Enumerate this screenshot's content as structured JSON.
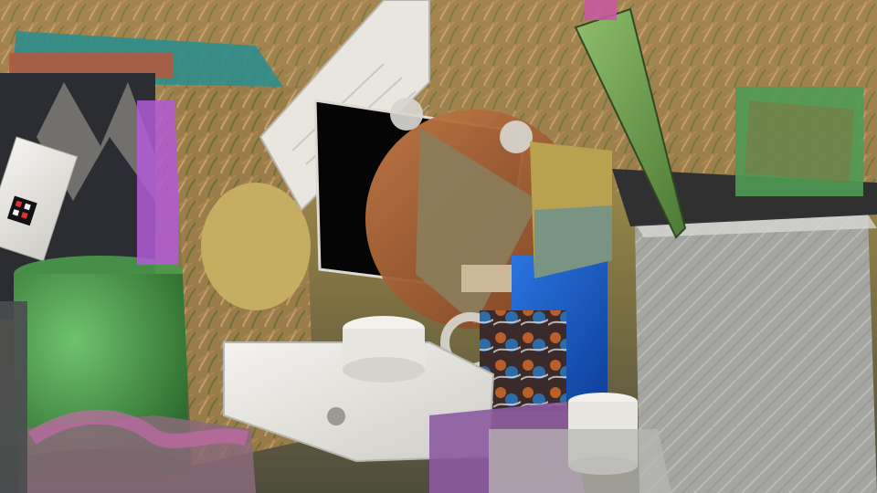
{
  "scene": {
    "kind": "rendered-3d-clutter",
    "palette": {
      "sky_top": "#c9a26a",
      "sky_mid": "#9a8a52",
      "foliage": "#7a7a3a",
      "white_objects": "#e6e4de",
      "black_panel": "#050505",
      "blue_panel": "#1e63c8",
      "green_cylinder": "#4b9a4b",
      "knife_blade": "#6f9a4a",
      "metal": "#a9a9a6",
      "wood": "#a8653a"
    }
  }
}
